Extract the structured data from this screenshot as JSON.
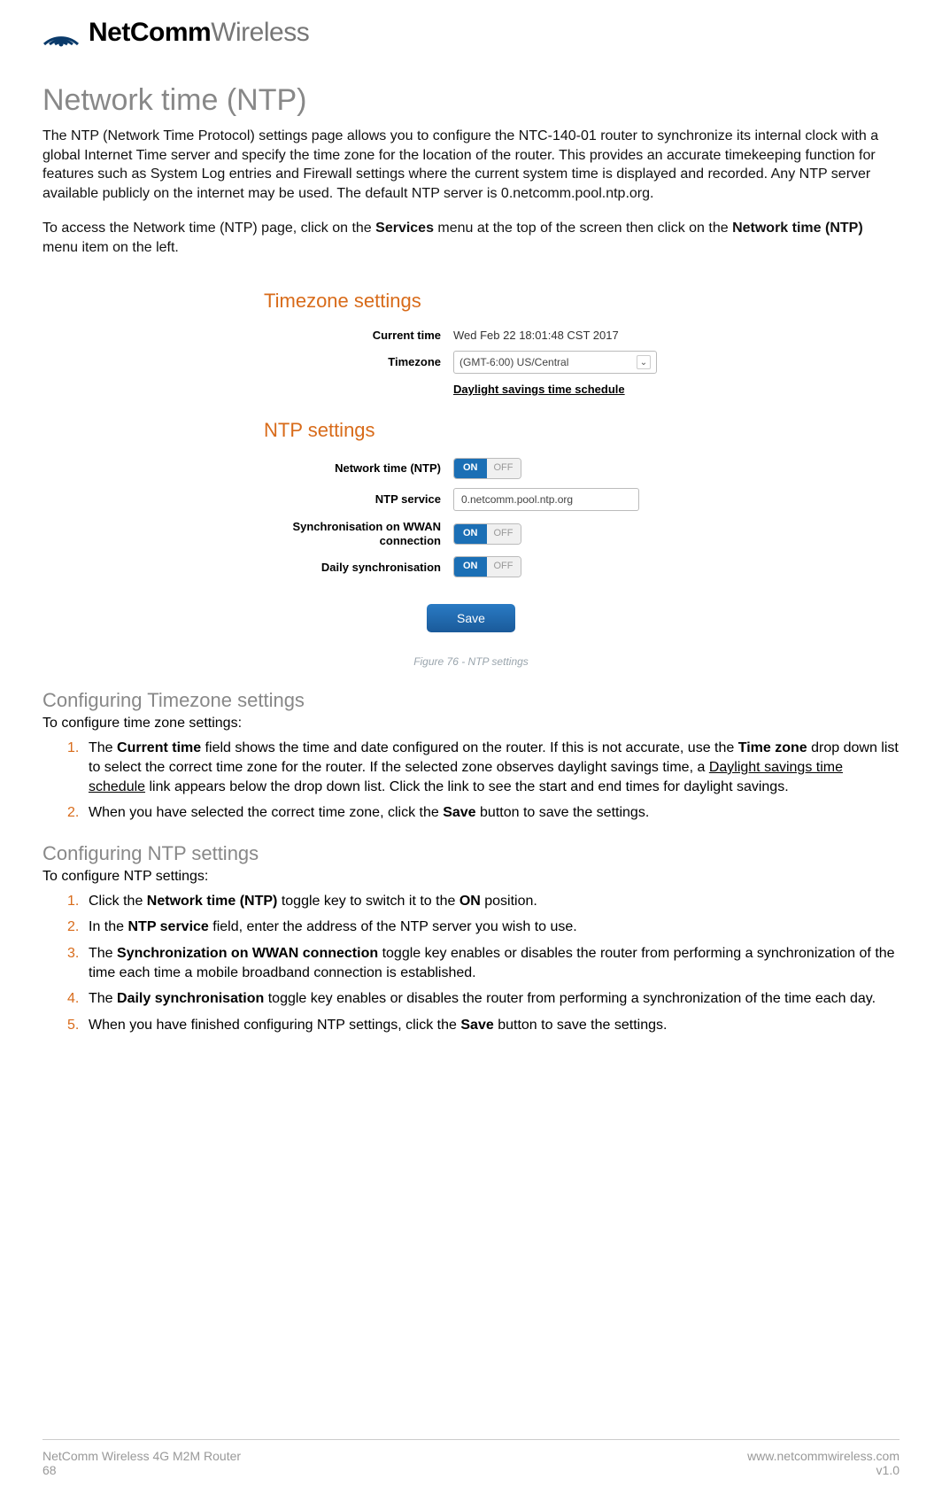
{
  "logo": {
    "bold": "NetComm",
    "light": "Wireless"
  },
  "title": "Network time (NTP)",
  "intro1": "The NTP (Network Time Protocol) settings page allows you to configure the NTC-140-01 router to synchronize its internal clock with a global Internet Time server and specify the time zone for the location of the router. This provides an accurate timekeeping function for features such as System Log entries and Firewall settings where the current system time is displayed and recorded. Any NTP server available publicly on the internet may be used. The default NTP server is 0.netcomm.pool.ntp.org.",
  "intro2_pre": "To access the Network time (NTP) page, click on the ",
  "intro2_b1": "Services",
  "intro2_mid": " menu at the top of the screen then click on the ",
  "intro2_b2": "Network time (NTP)",
  "intro2_post": " menu item on the left.",
  "screenshot": {
    "tz_heading": "Timezone settings",
    "current_time_label": "Current time",
    "current_time_value": "Wed Feb 22 18:01:48 CST 2017",
    "timezone_label": "Timezone",
    "timezone_value": "(GMT-6:00) US/Central",
    "dst_link": "Daylight savings time schedule",
    "ntp_heading": "NTP settings",
    "ntp_toggle_label": "Network time (NTP)",
    "ntp_service_label": "NTP service",
    "ntp_service_value": "0.netcomm.pool.ntp.org",
    "sync_wwan_label": "Synchronisation on WWAN connection",
    "daily_sync_label": "Daily synchronisation",
    "toggle_on": "ON",
    "toggle_off": "OFF",
    "save": "Save"
  },
  "fig_caption": "Figure 76 - NTP settings",
  "tz_section_title": "Configuring Timezone settings",
  "tz_intro": "To configure time zone settings:",
  "tz_steps": {
    "s1_a": "The ",
    "s1_b1": "Current time",
    "s1_b": " field shows the time and date configured on the router. If this is not accurate, use the ",
    "s1_b2": "Time zone",
    "s1_c": " drop down list to select the correct time zone for the router. If the selected zone observes daylight savings time, a ",
    "s1_u": "Daylight savings time schedule",
    "s1_d": " link appears below the drop down list. Click the link to see the start and end times for daylight savings.",
    "s2_a": "When you have selected the correct time zone, click the ",
    "s2_b": "Save",
    "s2_c": " button to save the settings."
  },
  "ntp_section_title": "Configuring NTP settings",
  "ntp_intro": "To configure NTP settings:",
  "ntp_steps": {
    "s1_a": "Click the ",
    "s1_b": "Network time (NTP)",
    "s1_c": " toggle key to switch it to the ",
    "s1_d": "ON",
    "s1_e": " position.",
    "s2_a": "In the ",
    "s2_b": "NTP service",
    "s2_c": " field, enter the address of the NTP server you wish to use.",
    "s3_a": "The ",
    "s3_b": "Synchronization on WWAN connection",
    "s3_c": " toggle key enables or disables the router from performing a synchronization of the time each time a mobile broadband connection is established.",
    "s4_a": "The ",
    "s4_b": "Daily synchronisation",
    "s4_c": " toggle key enables or disables the router from performing a synchronization of the time each day.",
    "s5_a": "When you have finished configuring NTP settings, click the ",
    "s5_b": "Save",
    "s5_c": " button to save the settings."
  },
  "footer": {
    "product": "NetComm Wireless 4G M2M Router",
    "page": "68",
    "url": "www.netcommwireless.com",
    "version": "v1.0"
  }
}
